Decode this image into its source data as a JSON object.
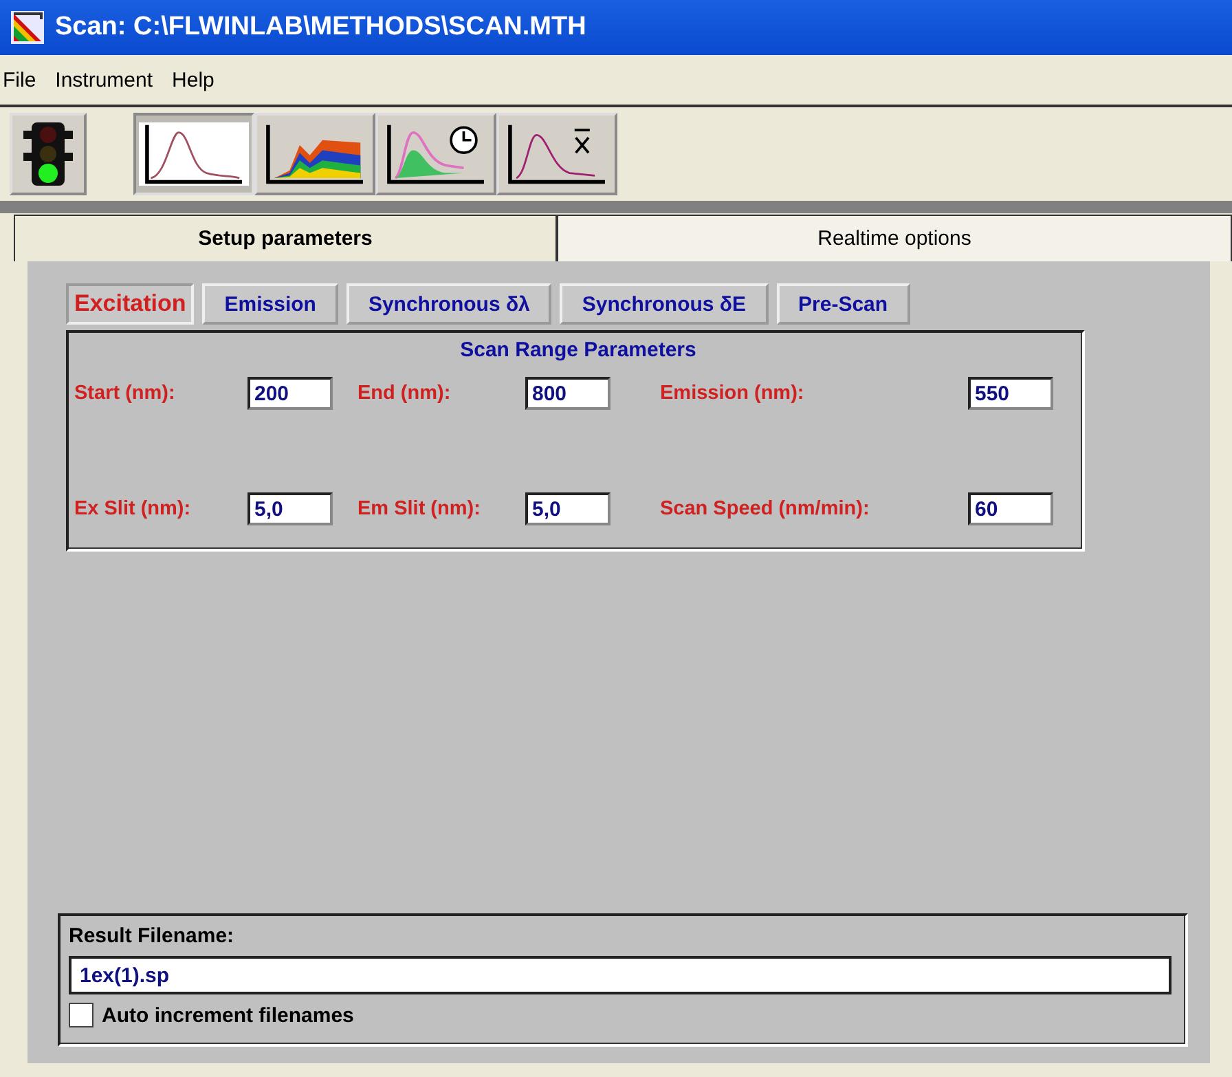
{
  "window": {
    "title": "Scan: C:\\FLWINLAB\\METHODS\\SCAN.MTH"
  },
  "menu": [
    "File",
    "Instrument",
    "Help"
  ],
  "toolbar": [
    {
      "kind": "status"
    },
    {
      "kind": "single",
      "selected": true
    },
    {
      "kind": "stacked",
      "selected": false
    },
    {
      "kind": "timed",
      "selected": false
    },
    {
      "kind": "mean",
      "selected": false
    }
  ],
  "tabs": [
    {
      "label": "Setup parameters",
      "selected": true
    },
    {
      "label": "Realtime options",
      "selected": false
    }
  ],
  "scan_types": [
    {
      "label": "Excitation",
      "selected": true
    },
    {
      "label": "Emission",
      "selected": false
    },
    {
      "label": "Synchronous δλ",
      "selected": false
    },
    {
      "label": "Synchronous δE",
      "selected": false
    },
    {
      "label": "Pre-Scan",
      "selected": false
    }
  ],
  "scan_range": {
    "title": "Scan Range Parameters",
    "rows": [
      [
        {
          "label": "Start (nm):",
          "value": "200"
        },
        {
          "label": "End (nm):",
          "value": "800"
        },
        {
          "label": "Emission (nm):",
          "value": "550"
        }
      ],
      [
        {
          "label": "Ex Slit (nm):",
          "value": "5,0"
        },
        {
          "label": "Em Slit (nm):",
          "value": "5,0"
        },
        {
          "label": "Scan Speed (nm/min):",
          "value": "60"
        }
      ]
    ]
  },
  "result": {
    "label": "Result Filename:",
    "value": "1ex(1).sp",
    "auto_increment": {
      "label": "Auto increment filenames",
      "checked": false
    }
  }
}
